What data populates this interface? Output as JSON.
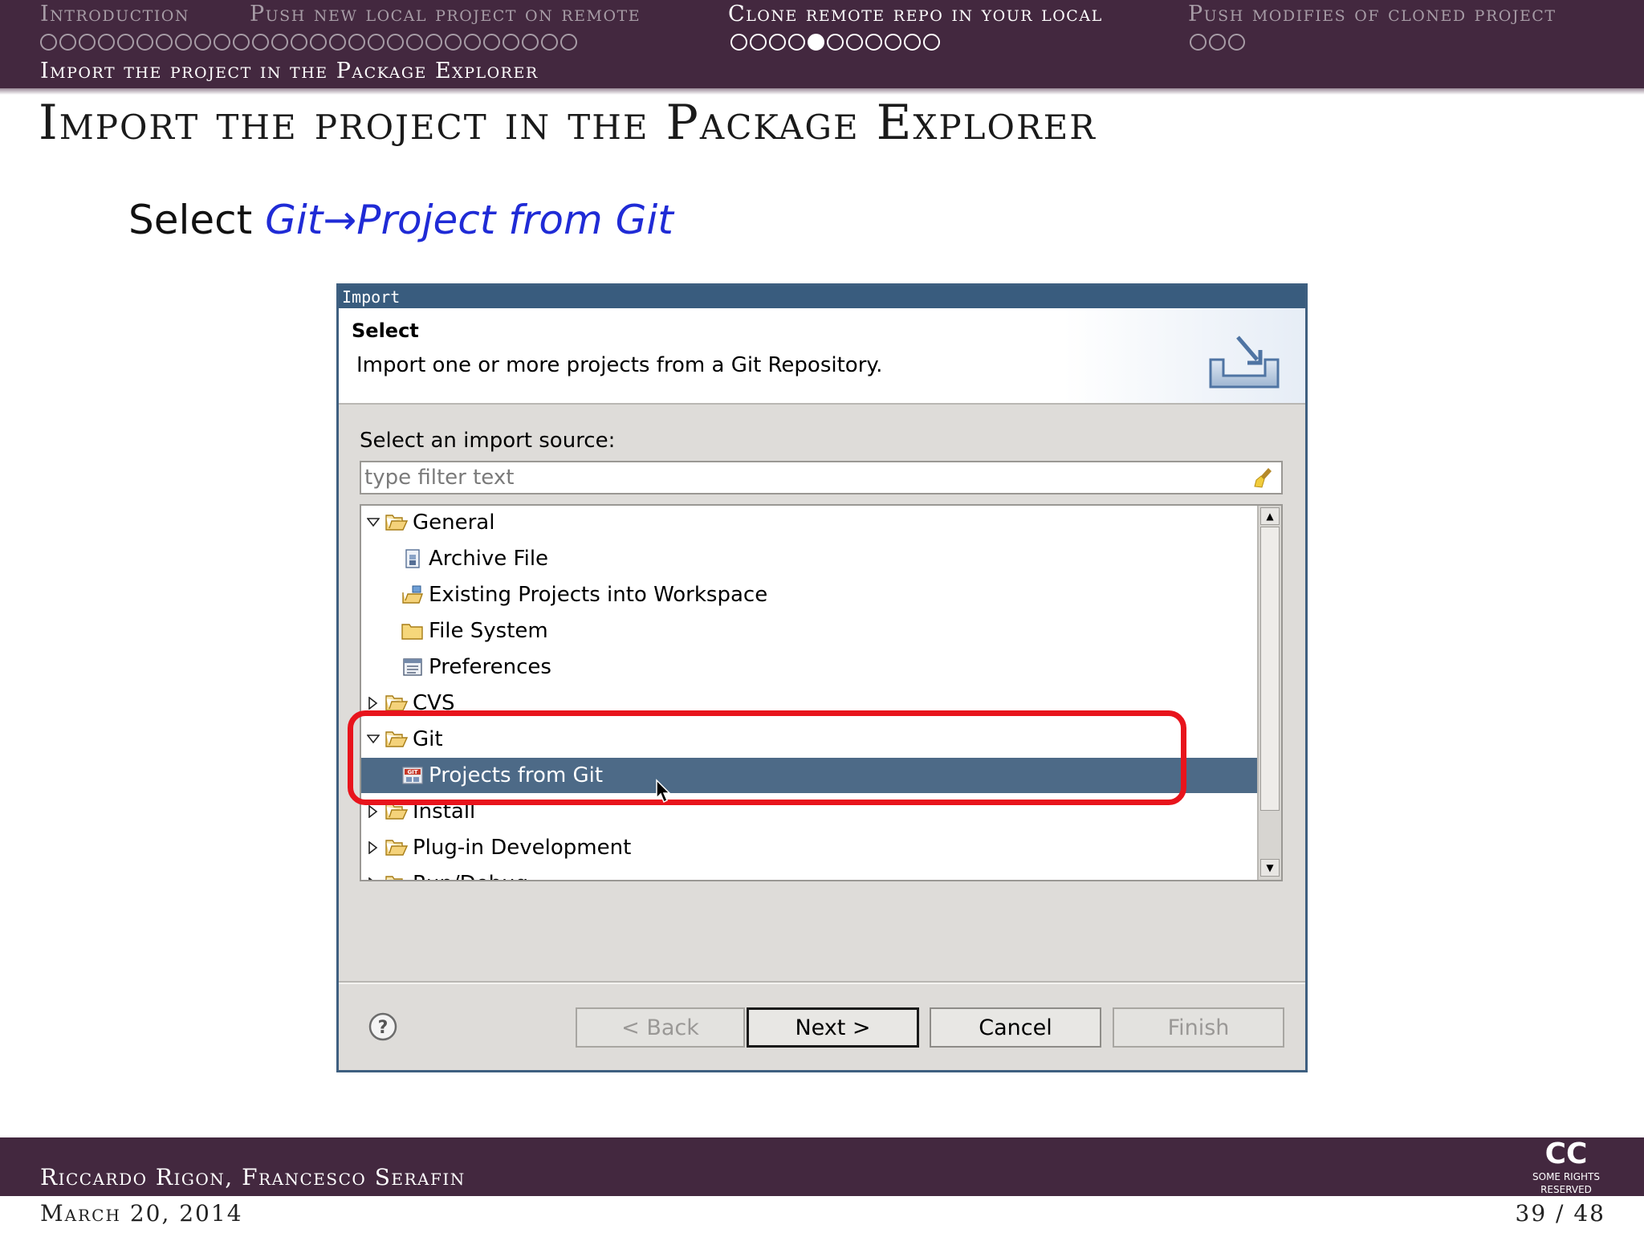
{
  "header": {
    "sections": [
      {
        "label": "Introduction",
        "dots": 11,
        "filled": -1,
        "active": false
      },
      {
        "label": "Push new local project on remote",
        "dots": 17,
        "filled": -1,
        "active": false
      },
      {
        "label": "Clone remote repo in your local",
        "dots": 11,
        "filled": 4,
        "active": true
      },
      {
        "label": "Push modifies of cloned project",
        "dots": 3,
        "filled": -1,
        "active": false
      }
    ],
    "subsection": "Import the project in the Package Explorer"
  },
  "frame": {
    "title": "Import the project in the Package Explorer",
    "instruction_prefix": "Select ",
    "instruction_path": "Git→Project from Git"
  },
  "dialog": {
    "window_title": "Import",
    "banner_heading": "Select",
    "banner_description": "Import one or more projects from a Git Repository.",
    "source_label": "Select an import source:",
    "filter_placeholder": "type filter text",
    "tree": [
      {
        "label": "General",
        "level": 0,
        "expander": "expanded",
        "icon": "folder-open-icon"
      },
      {
        "label": "Archive File",
        "level": 1,
        "expander": "none",
        "icon": "archive-file-icon"
      },
      {
        "label": "Existing Projects into Workspace",
        "level": 1,
        "expander": "none",
        "icon": "existing-projects-icon"
      },
      {
        "label": "File System",
        "level": 1,
        "expander": "none",
        "icon": "folder-closed-icon"
      },
      {
        "label": "Preferences",
        "level": 1,
        "expander": "none",
        "icon": "preferences-icon"
      },
      {
        "label": "CVS",
        "level": 0,
        "expander": "collapsed",
        "icon": "folder-open-icon"
      },
      {
        "label": "Git",
        "level": 0,
        "expander": "expanded",
        "icon": "folder-open-icon"
      },
      {
        "label": "Projects from Git",
        "level": 1,
        "expander": "none",
        "icon": "git-projects-icon",
        "selected": true
      },
      {
        "label": "Install",
        "level": 0,
        "expander": "collapsed",
        "icon": "folder-open-icon"
      },
      {
        "label": "Plug-in Development",
        "level": 0,
        "expander": "collapsed",
        "icon": "folder-open-icon"
      },
      {
        "label": "Run/Debug",
        "level": 0,
        "expander": "collapsed",
        "icon": "folder-open-icon"
      }
    ],
    "buttons": {
      "back": "< Back",
      "next": "Next >",
      "cancel": "Cancel",
      "finish": "Finish"
    }
  },
  "footer": {
    "authors": "Riccardo Rigon, Francesco Serafin",
    "date": "March 20, 2014",
    "page": "39 / 48",
    "license_logo": "CC",
    "license_text": "SOME RIGHTS RESERVED"
  },
  "colors": {
    "beamer_purple": "#43283f",
    "dialog_title_blue": "#395c7e",
    "selection_blue": "#4d6a87",
    "highlight_red": "#e8141c",
    "link_blue": "#1f2bd6"
  }
}
